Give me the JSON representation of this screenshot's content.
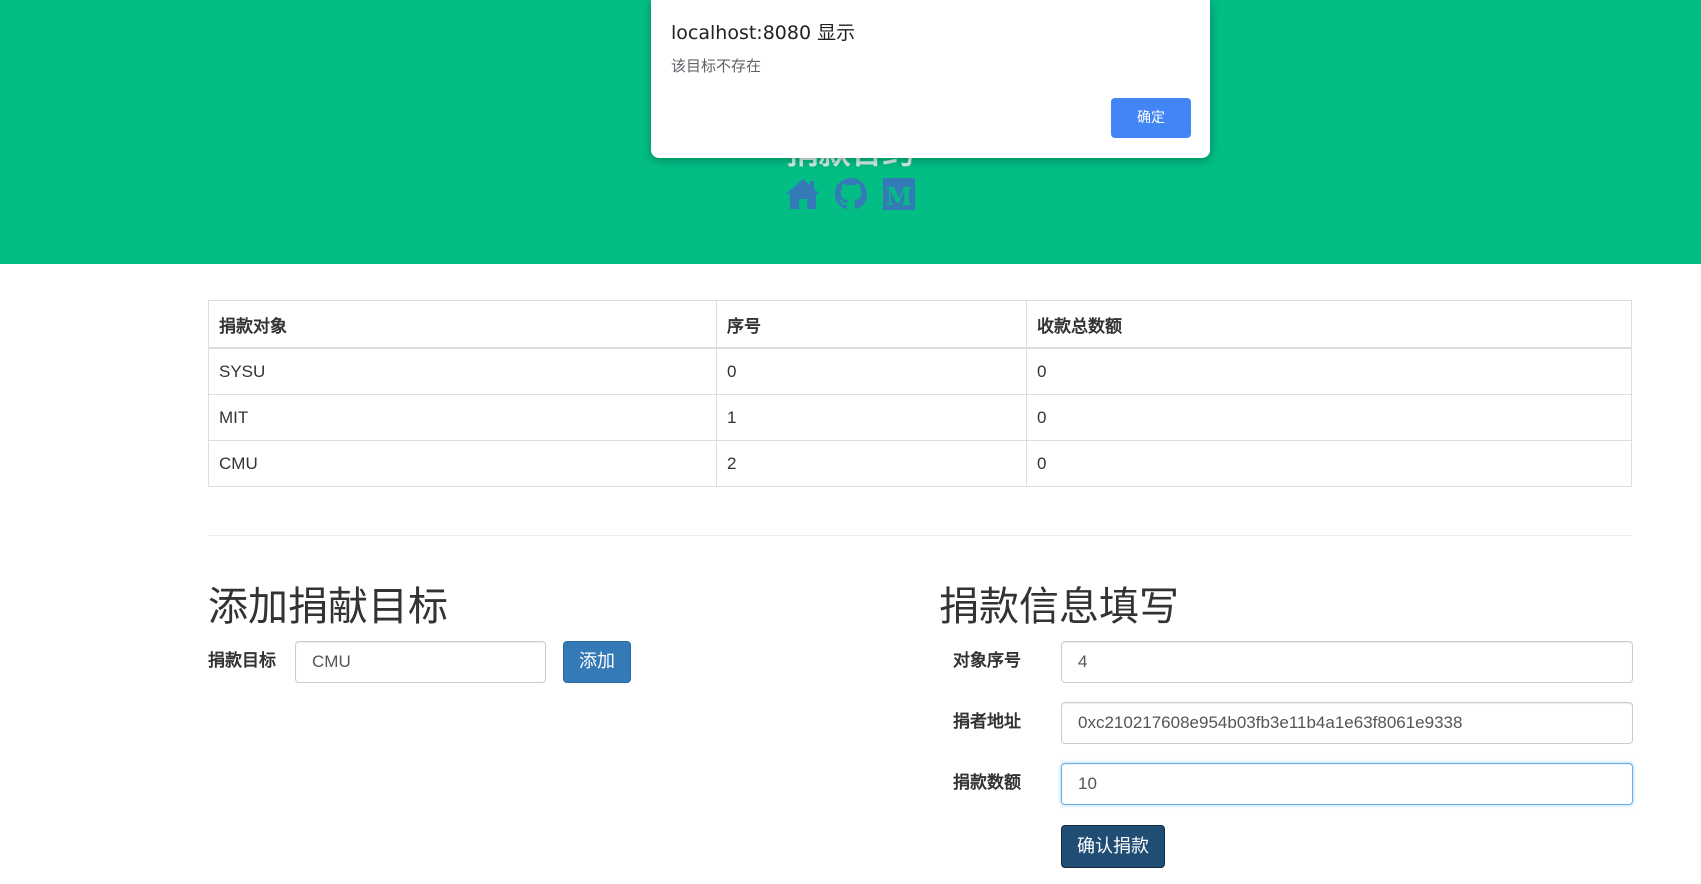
{
  "hero": {
    "title": "捐款合约",
    "icons": [
      "home-icon",
      "github-icon",
      "medium-icon"
    ],
    "bg_color": "#02be85",
    "icon_color": "#337ab7"
  },
  "table": {
    "headers": [
      "捐款对象",
      "序号",
      "收款总数额"
    ],
    "rows": [
      [
        "SYSU",
        "0",
        "0"
      ],
      [
        "MIT",
        "1",
        "0"
      ],
      [
        "CMU",
        "2",
        "0"
      ]
    ]
  },
  "add_target": {
    "heading": "添加捐献目标",
    "label": "捐款目标",
    "input_value": "CMU",
    "button_label": "添加"
  },
  "donation_form": {
    "heading": "捐款信息填写",
    "fields": [
      {
        "label": "对象序号",
        "value": "4"
      },
      {
        "label": "捐者地址",
        "value": "0xc210217608e954b03fb3e11b4a1e63f8061e9338"
      },
      {
        "label": "捐款数额",
        "value": "10"
      }
    ],
    "button_label": "确认捐款"
  },
  "alert": {
    "title": "localhost:8080 显示",
    "message": "该目标不存在",
    "ok_label": "确定",
    "ok_color": "#4285f4"
  }
}
